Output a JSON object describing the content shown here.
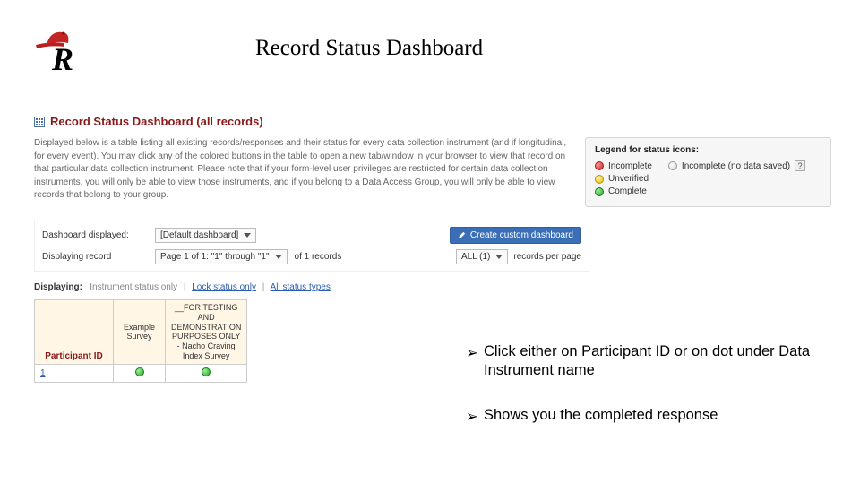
{
  "slide_title": "Record Status Dashboard",
  "dashboard": {
    "heading": "Record Status Dashboard (all records)",
    "description": "Displayed below is a table listing all existing records/responses and their status for every data collection instrument (and if longitudinal, for every event). You may click any of the colored buttons in the table to open a new tab/window in your browser to view that record on that particular data collection instrument. Please note that if your form-level user privileges are restricted for certain data collection instruments, you will only be able to view those instruments, and if you belong to a Data Access Group, you will only be able to view records that belong to your group."
  },
  "legend": {
    "title": "Legend for status icons:",
    "items": {
      "incomplete": "Incomplete",
      "incomplete_nodata": "Incomplete (no data saved)",
      "unverified": "Unverified",
      "complete": "Complete"
    }
  },
  "controls": {
    "dashboard_displayed_label": "Dashboard displayed:",
    "dashboard_select_value": "[Default dashboard]",
    "create_dashboard_btn": "Create custom dashboard",
    "displaying_record_label": "Displaying record",
    "page_select_value": "Page 1 of 1: \"1\" through \"1\"",
    "of_records_text": "of 1 records",
    "per_page_select_value": "ALL (1)",
    "records_per_page_text": "records per page"
  },
  "displaying_filter": {
    "prefix": "Displaying:",
    "option_instrument": "Instrument status only",
    "option_lock": "Lock status only",
    "option_all": "All status types"
  },
  "table": {
    "col_participant": "Participant ID",
    "col_example": "Example Survey",
    "col_nacho": "__FOR TESTING AND DEMONSTRATION PURPOSES ONLY - Nacho Craving Index Survey",
    "rows": [
      {
        "id": "1",
        "example_status": "complete",
        "nacho_status": "complete"
      }
    ]
  },
  "bullets": {
    "b1": "Click either on Participant ID or on dot under Data Instrument name",
    "b2": "Shows you the completed response"
  }
}
